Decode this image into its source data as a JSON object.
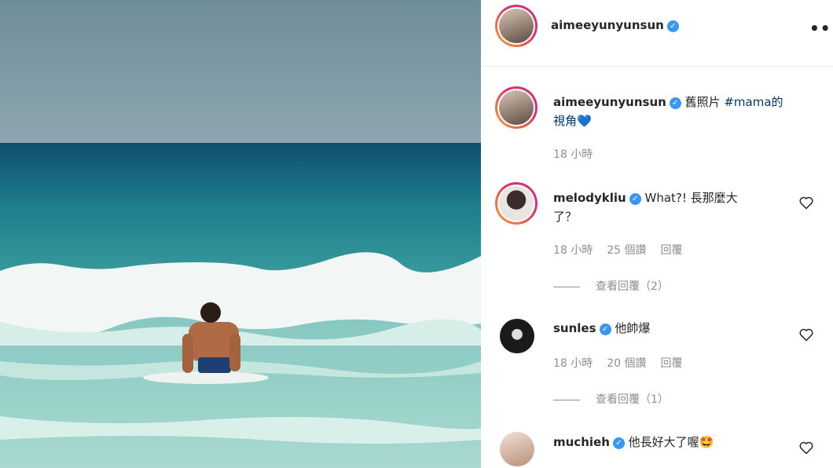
{
  "post": {
    "username": "aimeeyunyunsun",
    "verified_icon": "verified-check-icon",
    "more_icon": "more-options-icon",
    "more_label": "•••"
  },
  "caption": {
    "username": "aimeeyunyunsun",
    "text": "舊照片 ",
    "hashtag": "#mama的",
    "text2": "視角",
    "emoji": "💙",
    "time": "18 小時"
  },
  "comments": [
    {
      "username": "melodykliu",
      "text_line1": "What?! 長那麼大",
      "text_line2": "了？",
      "time": "18 小時",
      "likes": "25 個讚",
      "reply": "回覆",
      "view_replies": "查看回覆（2）"
    },
    {
      "username": "sunles",
      "text_line1": "他帥爆",
      "time": "18 小時",
      "likes": "20 個讚",
      "reply": "回覆",
      "view_replies": "查看回覆（1）"
    },
    {
      "username": "muchieh",
      "text_line1": "他長好大了喔",
      "emoji": "🤩"
    }
  ],
  "colors": {
    "accent": "#3897f0",
    "text": "#262626",
    "muted": "#8e8e8e"
  }
}
